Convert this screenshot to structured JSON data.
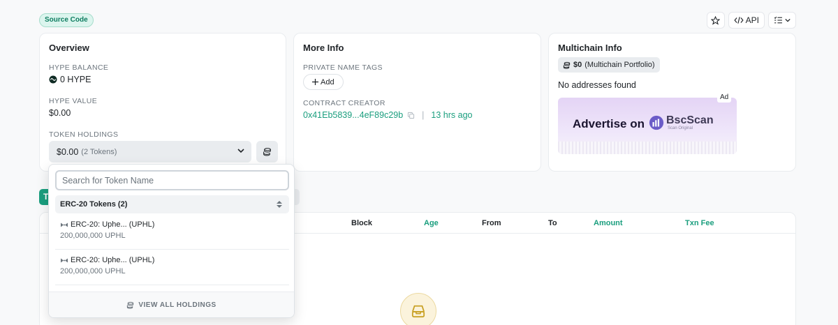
{
  "header": {
    "source_badge": "Source Code",
    "api_label": "API"
  },
  "overview": {
    "title": "Overview",
    "balance_label": "HYPE BALANCE",
    "balance_value": "0 HYPE",
    "value_label": "HYPE VALUE",
    "value_value": "$0.00",
    "holdings_label": "TOKEN HOLDINGS",
    "holdings_value": "$0.00",
    "holdings_count": "(2 Tokens)"
  },
  "more_info": {
    "title": "More Info",
    "tags_label": "PRIVATE NAME TAGS",
    "add_label": "Add",
    "creator_label": "CONTRACT CREATOR",
    "creator_address": "0x41Eb5839...4eF89c29b",
    "creator_age": "13 hrs ago"
  },
  "multichain": {
    "title": "Multichain Info",
    "portfolio_amount": "$0",
    "portfolio_label": "(Multichain Portfolio)",
    "no_addresses": "No addresses found",
    "ad_text": "Advertise on",
    "ad_brand": "BscScan",
    "ad_sub": "Scan Original",
    "ad_label": "Ad"
  },
  "tabs": {
    "first_fragment": "T"
  },
  "table": {
    "headers": [
      "Block",
      "Age",
      "From",
      "To",
      "Amount",
      "Txn Fee"
    ]
  },
  "dropdown": {
    "search_placeholder": "Search for Token Name",
    "group_label": "ERC-20 Tokens (2)",
    "items": [
      {
        "name": "ERC-20: Uphe... (UPHL)",
        "amount": "200,000,000 UPHL"
      },
      {
        "name": "ERC-20: Uphe... (UPHL)",
        "amount": "200,000,000 UPHL"
      }
    ],
    "footer_label": "VIEW ALL HOLDINGS"
  },
  "colors": {
    "accent": "#1a9e7e",
    "badge_bg": "#dcf5ee",
    "empty_icon": "#c9a227"
  }
}
